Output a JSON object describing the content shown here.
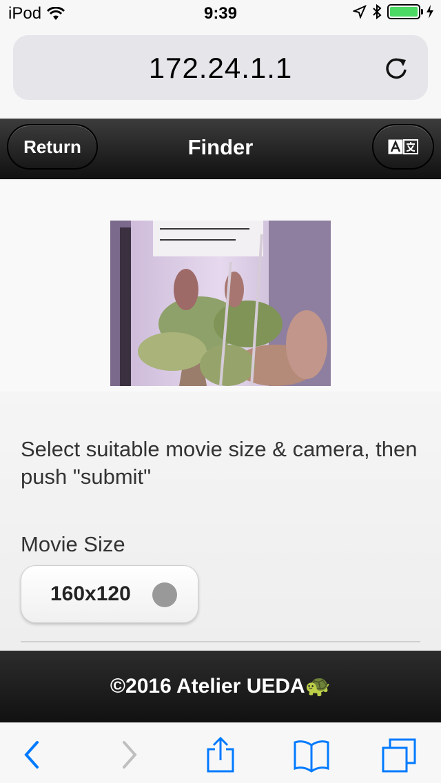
{
  "status": {
    "carrier": "iPod",
    "time": "9:39"
  },
  "browser": {
    "url": "172.24.1.1"
  },
  "nav": {
    "return_label": "Return",
    "title": "Finder"
  },
  "content": {
    "instructions": "Select suitable movie size & camera, then push \"submit\"",
    "movie_size_label": "Movie Size",
    "movie_size_value": "160x120"
  },
  "footer": {
    "copyright": "©2016 Atelier UEDA🐢"
  },
  "colors": {
    "accent": "#007aff",
    "navbar": "#1e1e1e",
    "battery": "#4cd964"
  },
  "icons": [
    "wifi-icon",
    "location-icon",
    "bluetooth-icon",
    "battery-icon",
    "charging-icon",
    "reload-icon",
    "translate-icon",
    "back-icon",
    "forward-icon",
    "share-icon",
    "bookmarks-icon",
    "tabs-icon"
  ]
}
